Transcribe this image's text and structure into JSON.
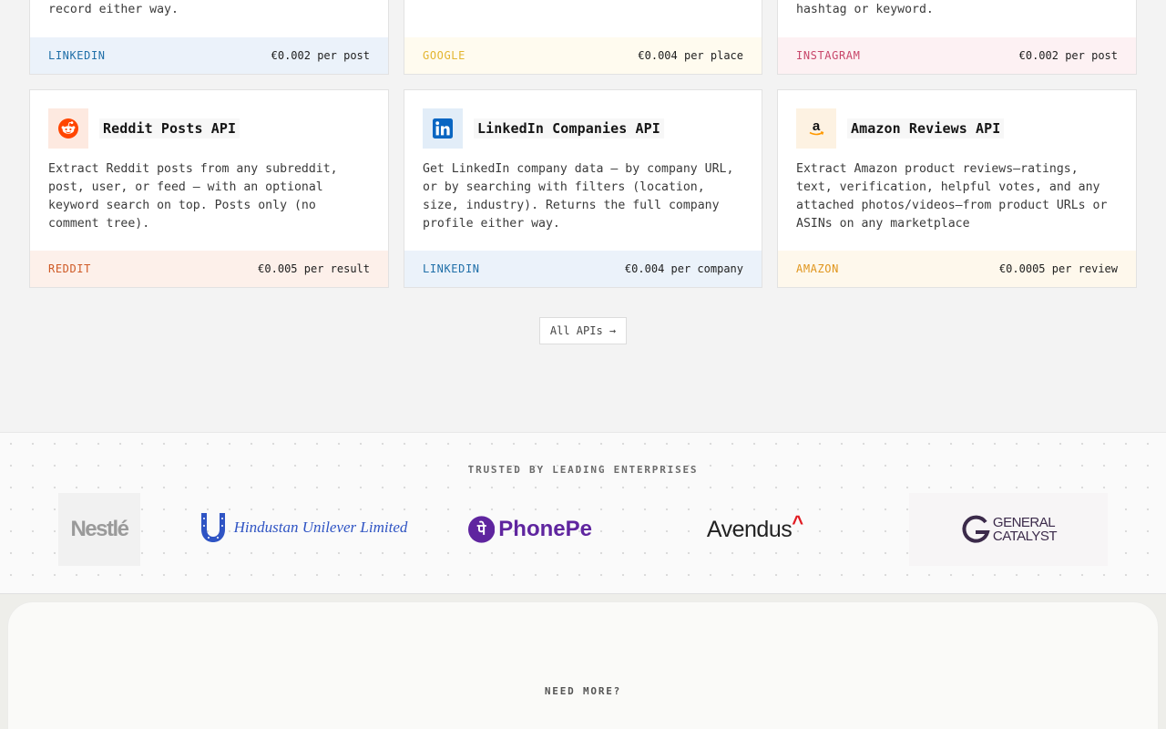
{
  "top_row": [
    {
      "description_tail": "record either way.",
      "platform": "LINKEDIN",
      "price": "€0.002 per post",
      "colors": {
        "footer_bg": "#ebf2fa",
        "platform": "#1f6fa8"
      }
    },
    {
      "description_tail": "",
      "platform": "GOOGLE",
      "price": "€0.004 per place",
      "colors": {
        "footer_bg": "#fffbef",
        "platform": "#e3b52f"
      }
    },
    {
      "description_tail": "hashtag or keyword.",
      "platform": "INSTAGRAM",
      "price": "€0.002 per post",
      "colors": {
        "footer_bg": "#fdf1f3",
        "platform": "#c8466a"
      }
    }
  ],
  "cards": [
    {
      "title": "Reddit Posts API",
      "icon": "reddit-icon",
      "description": "Extract Reddit posts from any subreddit, post, user, or feed — with an optional keyword search on top. Posts only (no comment tree).",
      "platform": "REDDIT",
      "price": "€0.005 per result",
      "colors": {
        "icon_bg": "#fde9e0",
        "footer_bg": "#fdf0ea",
        "platform": "#cf5a26"
      }
    },
    {
      "title": "LinkedIn Companies API",
      "icon": "linkedin-icon",
      "description": "Get LinkedIn company data — by company URL, or by searching with filters (location, size, industry). Returns the full company profile either way.",
      "platform": "LINKEDIN",
      "price": "€0.004 per company",
      "colors": {
        "icon_bg": "#e2edf8",
        "footer_bg": "#ebf2fa",
        "platform": "#1f6fa8"
      }
    },
    {
      "title": "Amazon Reviews API",
      "icon": "amazon-icon",
      "description": "Extract Amazon product reviews—ratings, text, verification, helpful votes, and any attached photos/videos—from product URLs or ASINs on any marketplace",
      "platform": "AMAZON",
      "price": "€0.0005 per review",
      "colors": {
        "icon_bg": "#fdf2e2",
        "footer_bg": "#fef8ec",
        "platform": "#e0951c"
      }
    }
  ],
  "all_apis_button": "All APIs →",
  "trusted": {
    "label": "TRUSTED BY LEADING ENTERPRISES",
    "logos": [
      {
        "name": "Nestlé",
        "text": "Nestlé",
        "color": "#9a9a9a"
      },
      {
        "name": "Hindustan Unilever Limited",
        "text": "Hindustan Unilever Limited",
        "color": "#2f54c4"
      },
      {
        "name": "PhonePe",
        "text": "PhonePe",
        "color": "#5f259f"
      },
      {
        "name": "Avendus",
        "text": "Avendus",
        "color": "#222222",
        "accent": "#e11b22"
      },
      {
        "name": "General Catalyst",
        "text_line1": "GENERAL",
        "text_line2": "CATALYST",
        "color": "#3b2a4a"
      }
    ]
  },
  "need_more": {
    "label": "NEED MORE?"
  }
}
